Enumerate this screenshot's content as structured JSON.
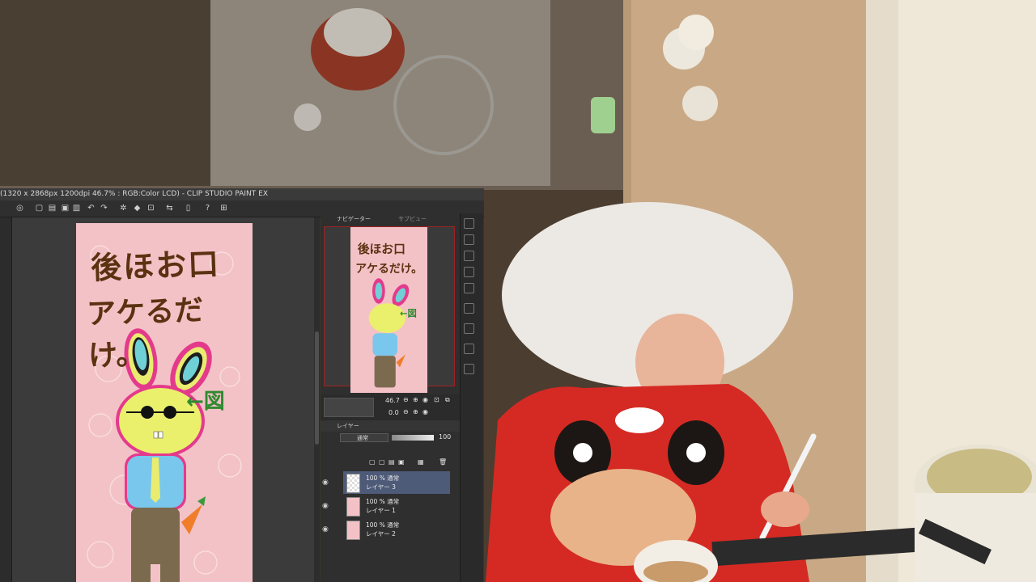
{
  "window": {
    "title": "(1320 x 2868px 1200dpi 46.7% : RGB:Color LCD) - CLIP STUDIO PAINT EX"
  },
  "panel": {
    "tabs": [
      {
        "label": "ナビゲーター"
      },
      {
        "label": "サブビュー"
      }
    ],
    "navigator": {
      "zoom": "46.7",
      "rotation": "0.0"
    },
    "layers_tab": "レイヤー",
    "blend_mode": "通常",
    "opacity": "100",
    "layers": [
      {
        "opacity": "100 % 通常",
        "name": "レイヤー 3",
        "selected": true
      },
      {
        "opacity": "100 % 通常",
        "name": "レイヤー 1",
        "selected": false
      },
      {
        "opacity": "100 % 通常",
        "name": "レイヤー 2",
        "selected": false
      }
    ]
  },
  "artwork": {
    "lines": [
      "後ほお口",
      "アケるだけ。"
    ],
    "note": "←図"
  },
  "colors": {
    "canvas_pink": "#f3c2c7",
    "selected_layer": "#4d5a78",
    "nav_frame": "#a02222"
  }
}
